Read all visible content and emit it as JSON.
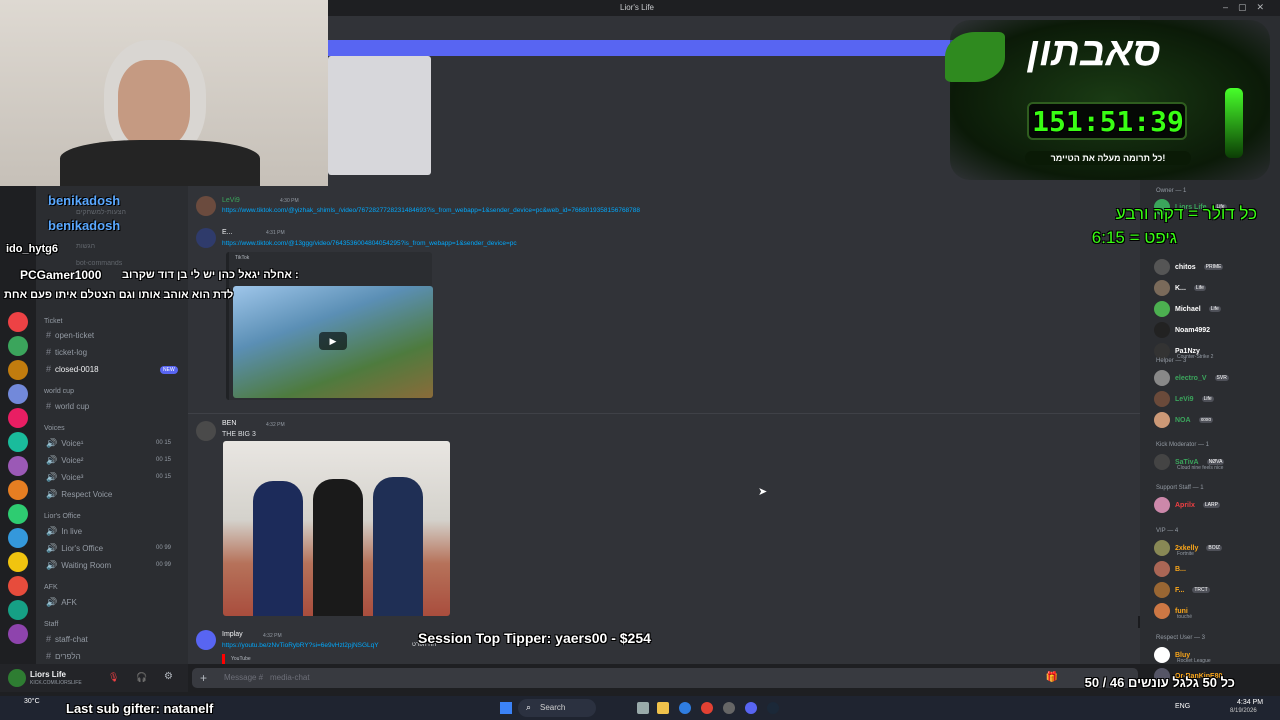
{
  "window": {
    "title": "Lior's Life"
  },
  "sidebar": {
    "categories": [
      {
        "label": "Ticket"
      },
      {
        "label": "world cup"
      },
      {
        "label": "Voices"
      },
      {
        "label": "Lior's Office"
      },
      {
        "label": "AFK"
      },
      {
        "label": "Staff"
      }
    ],
    "channels": [
      {
        "label": "open-ticket"
      },
      {
        "label": "ticket-log"
      },
      {
        "label": "closed-0018",
        "badge": "NEW"
      },
      {
        "label": "world cup"
      },
      {
        "label": "Voice¹",
        "count": "00 15"
      },
      {
        "label": "Voice²",
        "count": "00 15"
      },
      {
        "label": "Voice³",
        "count": "00 15"
      },
      {
        "label": "Respect Voice"
      },
      {
        "label": "In live"
      },
      {
        "label": "Lior's Office",
        "count": "00 99"
      },
      {
        "label": "Waiting Room",
        "count": "00 99"
      },
      {
        "label": "AFK"
      },
      {
        "label": "staff-chat"
      },
      {
        "label": "הלפרים"
      }
    ],
    "faded_items": [
      "הצעות-למשחקים",
      "הגשות",
      "bot-commands"
    ]
  },
  "user_panel": {
    "name": "Liors Life",
    "sub": "KICK.COM/LIORSLIFE"
  },
  "chat": {
    "messages": [
      {
        "author": "LeVi9",
        "time": "4:30 PM",
        "link": "https://www.tiktok.com/@yizhak_shimls_/video/7672827728231484693?is_from_webapp=1&sender_device=pc&web_id=7668019358156768788"
      },
      {
        "author": "E...",
        "time": "4:31 PM",
        "link": "https://www.tiktok.com/@13ggg/video/7643536004804054295?is_from_webapp=1&sender_device=pc",
        "embed_label": "TikTok"
      },
      {
        "author": "BEN",
        "time": "4:32 PM",
        "text": "THE BIG 3"
      },
      {
        "author": "Implay",
        "time": "4:32 PM",
        "link": "https://youtu.be/zNvTioRybRY?si=6e9vHzl2pjNSGLqY",
        "link_suffix": "חח הפרט",
        "embed_label": "YouTube"
      }
    ],
    "composer_placeholder": "Message #",
    "composer_channel": "media-chat"
  },
  "members": {
    "roles": [
      {
        "label": "Owner — 1"
      },
      {
        "label": "Helper — 3"
      },
      {
        "label": "Kick Moderator — 1"
      },
      {
        "label": "Support Staff — 1"
      },
      {
        "label": "VIP — 4"
      },
      {
        "label": "Respect User — 3"
      }
    ],
    "users": [
      {
        "name": "Liors Life",
        "tag": "Life",
        "color": "#3ba55c"
      },
      {
        "name": "chitos",
        "tag": "PRIME",
        "color": "#ffffff"
      },
      {
        "name": "K...",
        "tag": "Life",
        "color": "#ffffff"
      },
      {
        "name": "Michael",
        "tag": "Life",
        "color": "#ffffff"
      },
      {
        "name": "Noam4992",
        "tag": "",
        "color": "#ffffff"
      },
      {
        "name": "Pa1Nzy",
        "tag": "",
        "color": "#ffffff",
        "sub": "Counter-Strike 2"
      },
      {
        "name": "electro_V",
        "tag": "SVR",
        "color": "#3ba55c"
      },
      {
        "name": "LeVi9",
        "tag": "Life",
        "color": "#3ba55c"
      },
      {
        "name": "NOA",
        "tag": "xoxo",
        "color": "#3ba55c"
      },
      {
        "name": "SaTivA",
        "tag": "NØVA",
        "color": "#3ba55c",
        "sub": "Cloud nine feels nice"
      },
      {
        "name": "Aprilx",
        "tag": "LARP",
        "color": "#f23f43"
      },
      {
        "name": "2xkelly",
        "tag": "BOIZ",
        "color": "#faa61a",
        "sub": "Fortnite"
      },
      {
        "name": "B...",
        "tag": "",
        "color": "#faa61a"
      },
      {
        "name": "F...",
        "tag": "TRCT",
        "color": "#faa61a"
      },
      {
        "name": "funi",
        "tag": "",
        "color": "#faa61a",
        "sub": "touché"
      },
      {
        "name": "Bluy",
        "tag": "",
        "color": "#faa61a",
        "sub": "Rocket League"
      },
      {
        "name": "Or-RanKipE80",
        "tag": "",
        "color": "#faa61a"
      }
    ]
  },
  "overlay": {
    "chat_lines": [
      {
        "name": "benikadosh",
        "text": ""
      },
      {
        "name": "benikadosh",
        "text": ""
      },
      {
        "name": "ido_hytg6",
        "text": ""
      },
      {
        "name": "PCGamer1000",
        "text": "אחלה יגאל כהן יש לי בן דוד שקרוב :"
      },
      {
        "name": "",
        "text": "לדת הוא אוהב אותו וגם הצטלם איתו פעם אחת"
      }
    ],
    "subathon_title": "סאבתון",
    "timer": "151:51:39",
    "timer_sub": "כל תרומה מעלה את הטיימר!",
    "rule1": "כל דולר = דקה ורבע",
    "rule2": "גיפט = 6:15",
    "top_tipper": "Session Top Tipper: yaers00 - $254",
    "last_sub": "Last sub gifter: natanelf",
    "goal": "כל 50 גלגל עונשים 46 / 50"
  },
  "taskbar": {
    "search": "Search",
    "weather": "30°C",
    "lang": "ENG",
    "time": "4:34 PM",
    "date": "8/19/2026"
  },
  "colors": {
    "accent": "#5865f2",
    "chat_bg": "#313338",
    "sidebar_bg": "#2b2d31",
    "timer_green": "#39ff14"
  }
}
